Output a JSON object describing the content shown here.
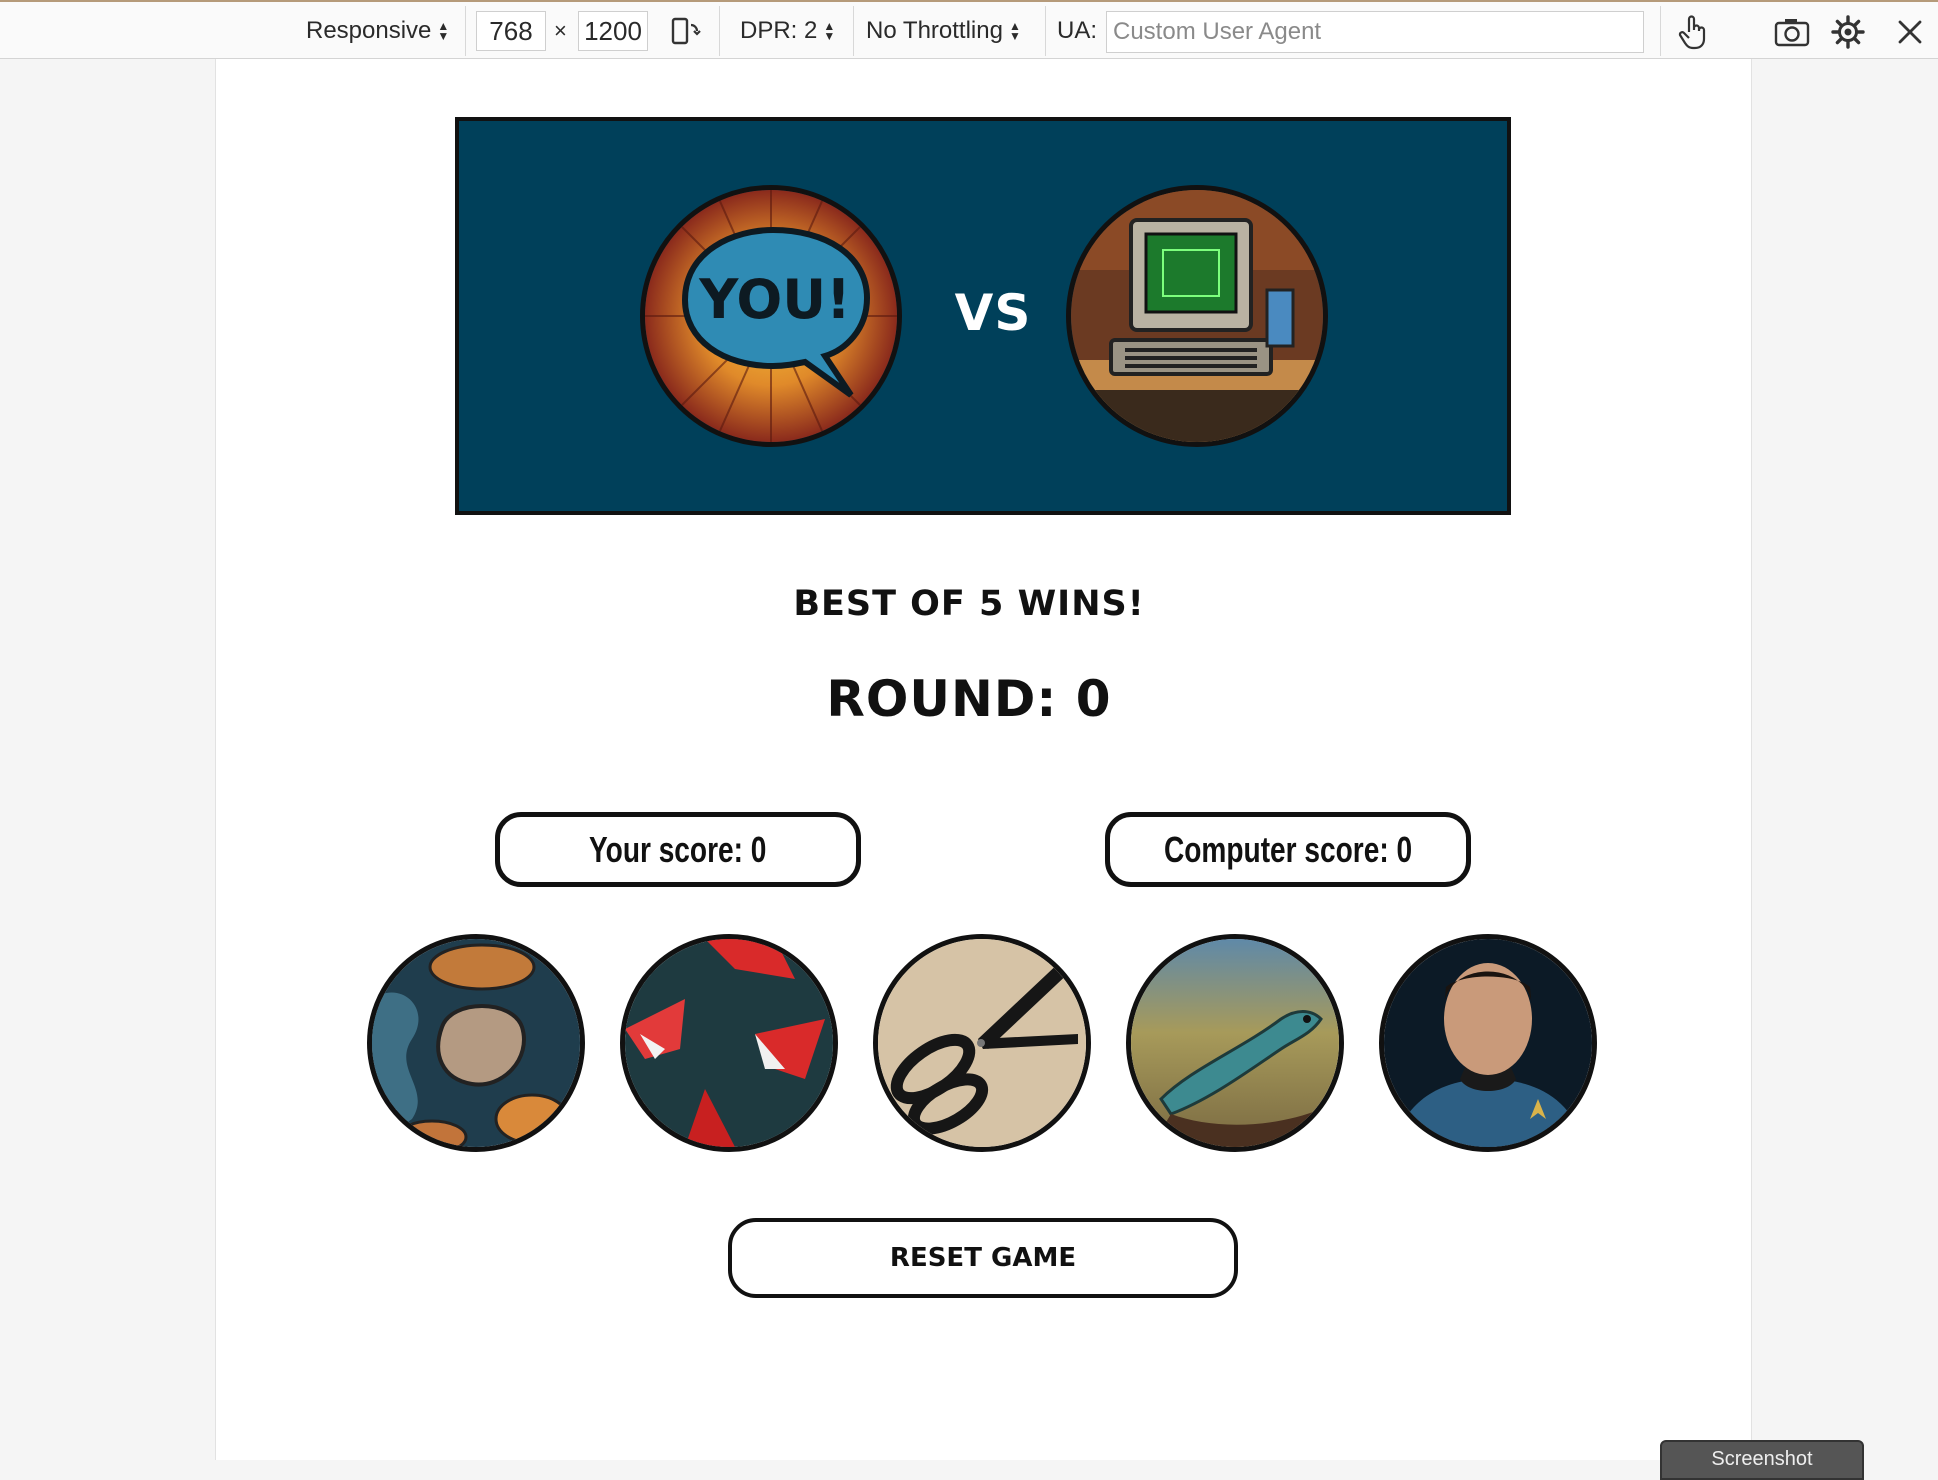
{
  "devtools": {
    "device_mode": "Responsive",
    "width": "768",
    "times": "×",
    "height": "1200",
    "dpr": "DPR: 2",
    "throttling": "No Throttling",
    "ua_label": "UA:",
    "ua_placeholder": "Custom User Agent",
    "screenshot_label": "Screenshot"
  },
  "game": {
    "hero": {
      "player_label": "YOU!",
      "vs_label": "VS"
    },
    "best_of": "BEST OF 5 WINS!",
    "round": "ROUND: 0",
    "player_score": "Your score: 0",
    "computer_score": "Computer score: 0",
    "choices": [
      "rock",
      "paper",
      "scissors",
      "lizard",
      "spock"
    ],
    "reset_label": "RESET GAME"
  },
  "colors": {
    "hero_bg": "#00405a",
    "border": "#111111",
    "page_bg": "#ffffff",
    "outer_bg": "#f5f5f5"
  }
}
